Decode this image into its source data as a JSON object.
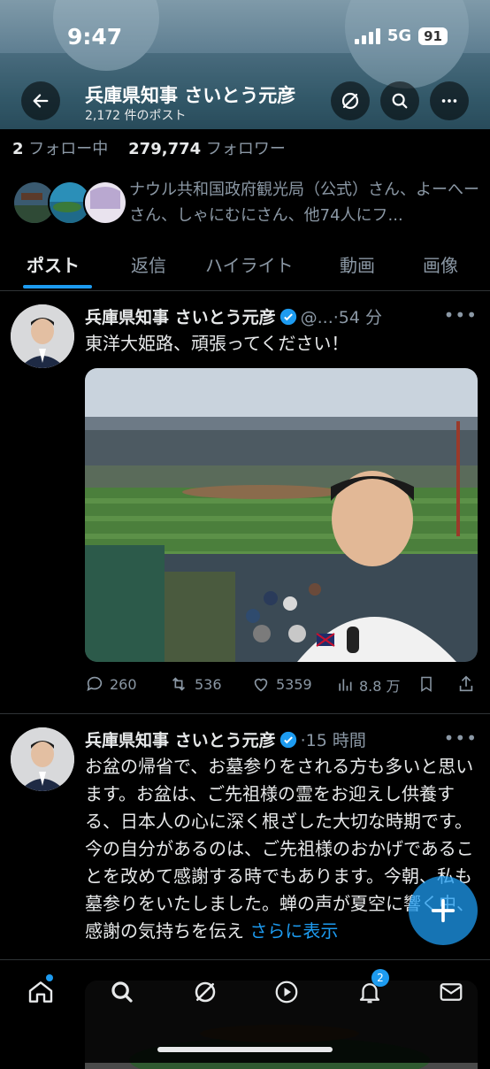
{
  "status_bar": {
    "time": "9:47",
    "network": "5G",
    "battery": "91"
  },
  "header": {
    "title": "兵庫県知事 さいとう元彦",
    "post_count": "2,172 件のポスト",
    "back_icon": "arrow-left-icon",
    "actions": [
      "grok-icon",
      "search-icon",
      "more-icon"
    ]
  },
  "profile_stats": {
    "following_count": "2",
    "following_label": "フォロー中",
    "followers_count": "279,774",
    "followers_label": "フォロワー"
  },
  "followers_you_know": {
    "text": "ナウル共和国政府観光局（公式）さん、よーへーさん、しゃにむにさん、他74人にフ..."
  },
  "tabs": [
    "ポスト",
    "返信",
    "ハイライト",
    "動画",
    "画像"
  ],
  "active_tab": "ポスト",
  "posts": [
    {
      "author": "兵庫県知事 さいとう元彦",
      "handle": "@...",
      "time": "54 分",
      "text": "東洋大姫路、頑張ってください！",
      "stats": {
        "replies": "260",
        "reposts": "536",
        "likes": "5359",
        "views": "8.8 万"
      }
    },
    {
      "author": "兵庫県知事 さいとう元彦",
      "time": "15 時間",
      "text": "お盆の帰省で、お墓参りをされる方も多いと思います。お盆は、ご先祖様の霊をお迎えし供養する、日本人の心に深く根ざした大切な時期です。今の自分があるのは、ご先祖様のおかげであることを改めて感謝する時でもあります。今朝、私も墓参りをいたしました。蝉の声が夏空に響く中、感謝の気持ちを伝え",
      "show_more": "さらに表示"
    }
  ],
  "bottom_nav": {
    "items": [
      "home-icon",
      "search-icon",
      "grok-icon",
      "play-icon",
      "bell-icon",
      "mail-icon"
    ],
    "notification_badge": "2"
  },
  "colors": {
    "accent": "#1d9bf0",
    "muted": "#8b98a5",
    "background": "#000000"
  }
}
